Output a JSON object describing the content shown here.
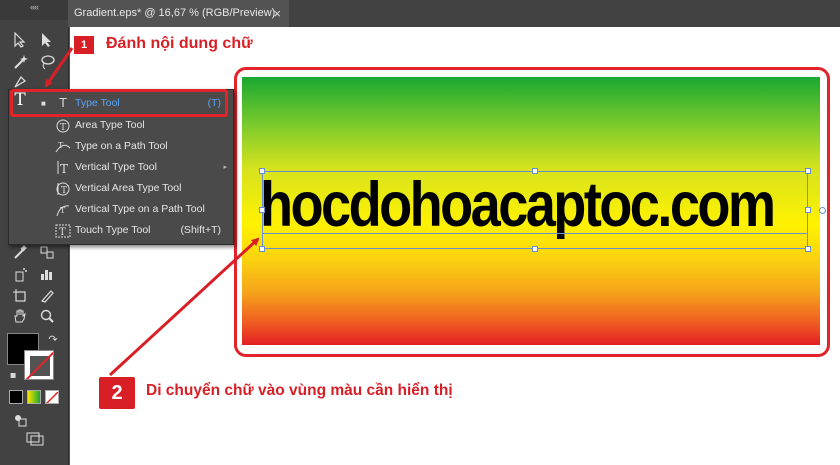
{
  "document_tab": {
    "title": "Gradient.eps* @ 16,67 % (RGB/Preview)",
    "close_glyph": "×"
  },
  "toolbar": {
    "grip": "««",
    "type_tool_glyph": "T"
  },
  "flyout": {
    "items": [
      {
        "label": "Type Tool",
        "shortcut": "(T)",
        "icon": "type-icon",
        "glyph": "T",
        "active": true
      },
      {
        "label": "Area Type Tool",
        "shortcut": "",
        "icon": "area-type-icon",
        "glyph": "⊤"
      },
      {
        "label": "Type on a Path Tool",
        "shortcut": "",
        "icon": "type-on-path-icon",
        "glyph": "⤳"
      },
      {
        "label": "Vertical Type Tool",
        "shortcut": "",
        "icon": "vertical-type-icon",
        "glyph": "↓T"
      },
      {
        "label": "Vertical Area Type Tool",
        "shortcut": "",
        "icon": "vertical-area-type-icon",
        "glyph": "⊤"
      },
      {
        "label": "Vertical Type on a Path Tool",
        "shortcut": "",
        "icon": "vertical-type-path-icon",
        "glyph": "⤳"
      },
      {
        "label": "Touch Type Tool",
        "shortcut": "(Shift+T)",
        "icon": "touch-type-icon",
        "glyph": "T"
      }
    ]
  },
  "canvas": {
    "headline": "hocdohoacaptoc.com"
  },
  "callouts": {
    "step1_number": "1",
    "step1_text": "Đánh nội dung chữ",
    "step2_number": "2",
    "step2_text": "Di chuyển chữ vào vùng màu cần hiển thị"
  },
  "colors": {
    "accent_red": "#d91f26",
    "menu_highlight_blue": "#5ba3f5",
    "gradient_top": "#1aa832",
    "gradient_mid": "#fff200",
    "gradient_bottom": "#e31e24"
  }
}
